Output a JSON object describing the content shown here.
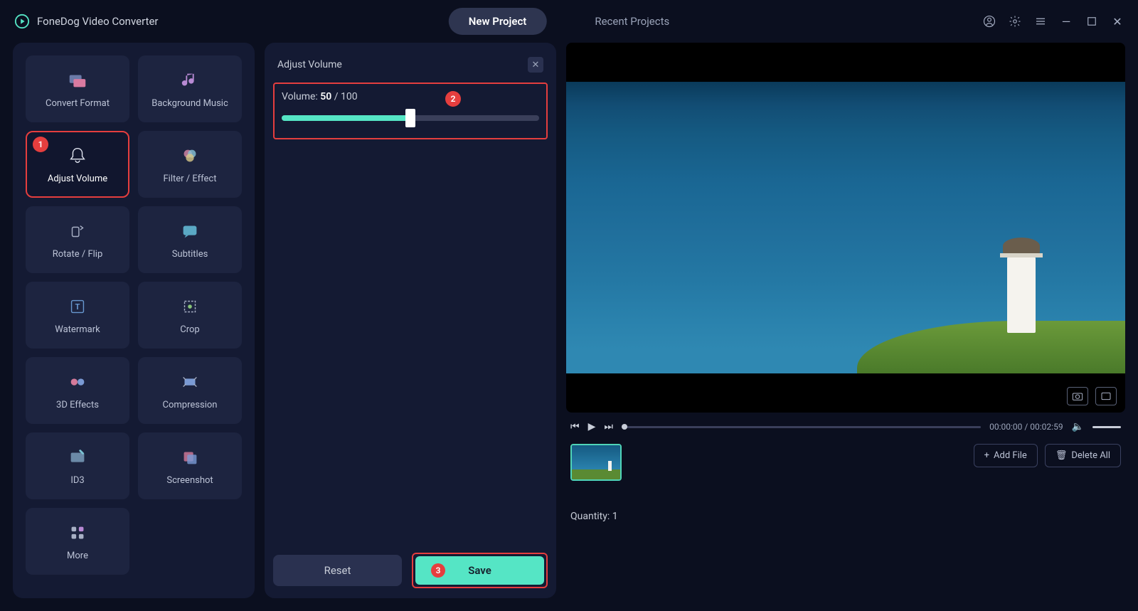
{
  "app": {
    "title": "FoneDog Video Converter"
  },
  "tabs": {
    "new_project": "New Project",
    "recent_projects": "Recent Projects"
  },
  "sidebar": {
    "tools": [
      {
        "label": "Convert Format"
      },
      {
        "label": "Background Music"
      },
      {
        "label": "Adjust Volume"
      },
      {
        "label": "Filter / Effect"
      },
      {
        "label": "Rotate / Flip"
      },
      {
        "label": "Subtitles"
      },
      {
        "label": "Watermark"
      },
      {
        "label": "Crop"
      },
      {
        "label": "3D Effects"
      },
      {
        "label": "Compression"
      },
      {
        "label": "ID3"
      },
      {
        "label": "Screenshot"
      },
      {
        "label": "More"
      }
    ]
  },
  "center": {
    "title": "Adjust Volume",
    "volume": {
      "prefix": "Volume: ",
      "current": "50",
      "sep": " / ",
      "max": "100",
      "percent": 50
    },
    "reset": "Reset",
    "save": "Save"
  },
  "player": {
    "time_current": "00:00:00",
    "time_sep": " / ",
    "time_total": "00:02:59"
  },
  "right_actions": {
    "add_file": "Add File",
    "delete_all": "Delete All"
  },
  "file_list": {
    "quantity_label": "Quantity: ",
    "quantity_value": "1"
  },
  "annotations": {
    "b1": "1",
    "b2": "2",
    "b3": "3"
  }
}
